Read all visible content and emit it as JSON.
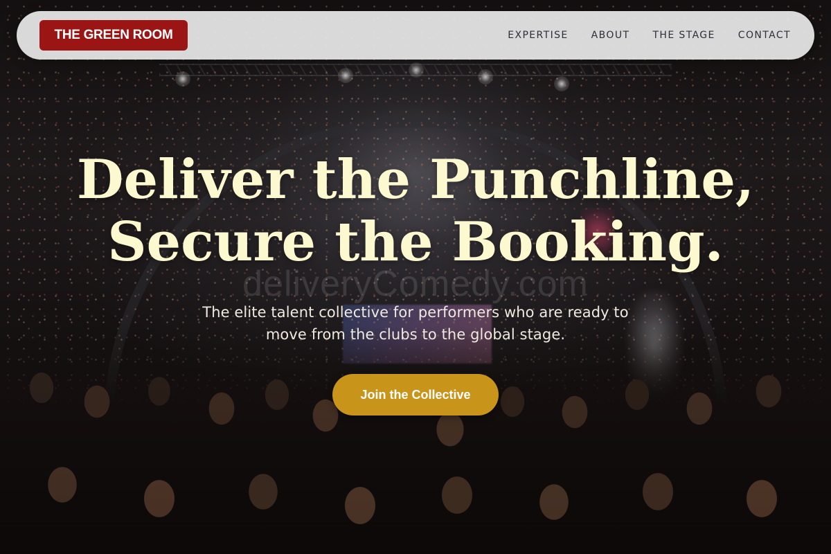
{
  "watermark": "deliveryComedy.com",
  "navbar": {
    "brand": "THE GREEN ROOM",
    "links": [
      {
        "label": "EXPERTISE"
      },
      {
        "label": "ABOUT"
      },
      {
        "label": "THE STAGE"
      },
      {
        "label": "CONTACT"
      }
    ]
  },
  "hero": {
    "title_line1": "Deliver the Punchline,",
    "title_line2": "Secure the Booking.",
    "subtitle": "The elite talent collective for performers who are ready to move from the clubs to the global stage.",
    "cta_label": "Join the Collective"
  },
  "colors": {
    "brand_red": "#9b1515",
    "cta_gold": "#c8951a",
    "title_cream": "#fcf8cf",
    "navbar_bg": "#e8e8e8"
  }
}
